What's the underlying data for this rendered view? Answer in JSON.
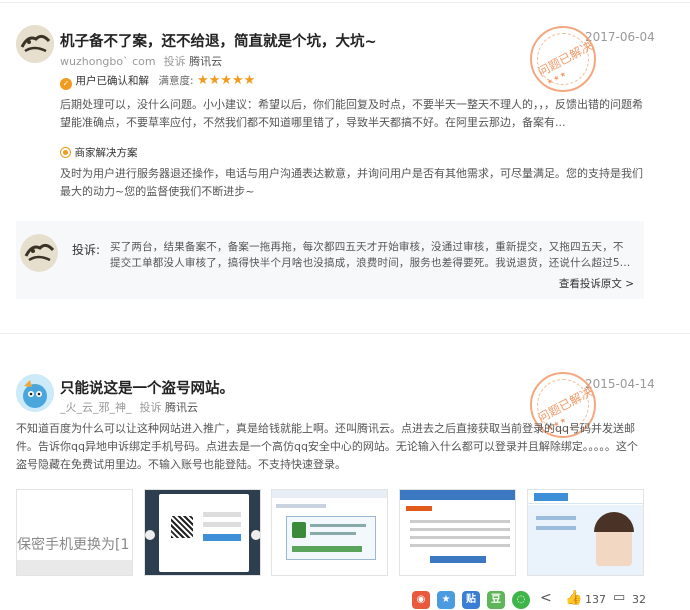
{
  "review1": {
    "title": "机子备不了案，还不给退，简直就是个坑，大坑~",
    "date": "2017-06-04",
    "author": "wuzhongbo` com",
    "complaint_verb": "投诉",
    "company": "腾讯云",
    "resolution_status": "用户已确认和解",
    "satisfaction_label": "满意度:",
    "stars": "★★★★★",
    "stamp_text": "问题已解决",
    "user_text": "后期处理可以，没什么问题。小小建议：希望以后，你们能回复及时点，不要半天一整天不理人的，，，反馈出错的问题希望能准确点，不要草率应付，不然我们都不知道哪里错了，导致半天都搞不好。在阿里云那边，备案有...",
    "merchant_title": "商家解决方案",
    "merchant_text": "及时为用户进行服务器退还操作，电话与用户沟通表达歉意，并询问用户是否有其他需求，可尽量满足。您的支持是我们最大的动力~您的监督使我们不断进步~",
    "complaint_label": "投诉:",
    "complaint_text": "买了两台，结果备案不，备案一拖再拖，每次都四五天才开始审核，没通过审核，重新提交，又拖四五天，不提交工单都没人审核了，搞得快半个月啥也没搞成，浪费时间，服务也差得要死。我说退货，还说什么超过5...",
    "view_original": "查看投诉原文 >"
  },
  "review2": {
    "title": "只能说这是一个盗号网站。",
    "date": "2015-04-14",
    "author": "_火_云_邪_神_",
    "complaint_verb": "投诉",
    "company": "腾讯云",
    "stamp_text": "问题已解决",
    "text": "不知道百度为什么可以让这种网站进入推广，真是给钱就能上啊。还叫腾讯云。点进去之后直接获取当前登录的qq号码并发送邮件。告诉你qq异地申诉绑定手机号码。点进去是一个高仿qq安全中心的网站。无论输入什么都可以登录并且解除绑定。。。。。这个盗号隐藏在免费试用里边。不输入账号也能登陆。不支持快速登录。",
    "thumb1_text": "保密手机更换为[1"
  },
  "footer": {
    "like_count": "137",
    "comment_count": "32"
  },
  "colors": {
    "accent_orange": "#f29a1d",
    "stamp": "#ef8a52"
  }
}
